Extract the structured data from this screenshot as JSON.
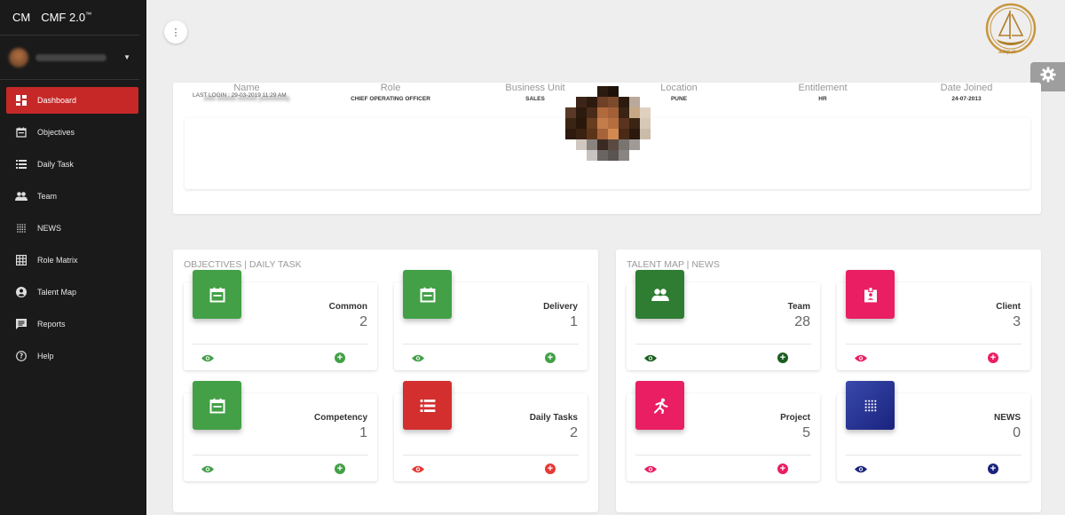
{
  "brand": {
    "short": "CM",
    "name": "CMF 2.0",
    "tm": "™"
  },
  "sidebar": {
    "items": [
      {
        "label": "Dashboard",
        "icon": "dashboard-icon",
        "active": true
      },
      {
        "label": "Objectives",
        "icon": "calendar-icon"
      },
      {
        "label": "Daily Task",
        "icon": "list-icon"
      },
      {
        "label": "Team",
        "icon": "people-icon"
      },
      {
        "label": "NEWS",
        "icon": "dots-grid-icon"
      },
      {
        "label": "Role Matrix",
        "icon": "grid-icon"
      },
      {
        "label": "Talent Map",
        "icon": "account-circle-icon"
      },
      {
        "label": "Reports",
        "icon": "report-icon"
      },
      {
        "label": "Help",
        "icon": "help-icon"
      }
    ]
  },
  "logo": {
    "text": "adap.in"
  },
  "profile": {
    "last_login": "LAST LOGIN : 29-03-2019 11:29 AM",
    "fields": [
      {
        "label": "Name",
        "value": "XXX XXXXX XXXXX (XXXXXXX)"
      },
      {
        "label": "Role",
        "value": "CHIEF OPERATING OFFICER"
      },
      {
        "label": "Business Unit",
        "value": "SALES"
      },
      {
        "label": "Location",
        "value": "PUNE"
      },
      {
        "label": "Entitlement",
        "value": "HR"
      },
      {
        "label": "Date Joined",
        "value": "24-07-2013"
      }
    ]
  },
  "sections": {
    "objectives": {
      "title": "OBJECTIVES | DAILY TASK",
      "tiles": [
        {
          "label": "Common",
          "count": "2",
          "color": "#43a047",
          "icon": "calendar-icon",
          "view_color": "#43a047",
          "add_color": "#43a047"
        },
        {
          "label": "Delivery",
          "count": "1",
          "color": "#43a047",
          "icon": "calendar-icon",
          "view_color": "#43a047",
          "add_color": "#43a047"
        },
        {
          "label": "Competency",
          "count": "1",
          "color": "#43a047",
          "icon": "calendar-icon",
          "view_color": "#43a047",
          "add_color": "#43a047"
        },
        {
          "label": "Daily Tasks",
          "count": "2",
          "color": "#e53935",
          "icon": "list-icon",
          "view_color": "#e53935",
          "add_color": "#e53935"
        }
      ]
    },
    "talent": {
      "title": "TALENT MAP | NEWS",
      "tiles": [
        {
          "label": "Team",
          "count": "28",
          "color": "#2e7d32",
          "icon": "people-icon",
          "view_color": "#1b5e20",
          "add_color": "#1b5e20"
        },
        {
          "label": "Client",
          "count": "3",
          "color": "#e91e63",
          "icon": "badge-icon",
          "view_color": "#e91e63",
          "add_color": "#e91e63"
        },
        {
          "label": "Project",
          "count": "5",
          "color": "#e91e63",
          "icon": "runner-icon",
          "view_color": "#e91e63",
          "add_color": "#e91e63"
        },
        {
          "label": "NEWS",
          "count": "0",
          "color": "#303f9f",
          "icon": "dots-grid-icon",
          "view_color": "#1a237e",
          "add_color": "#1a237e"
        }
      ]
    }
  }
}
